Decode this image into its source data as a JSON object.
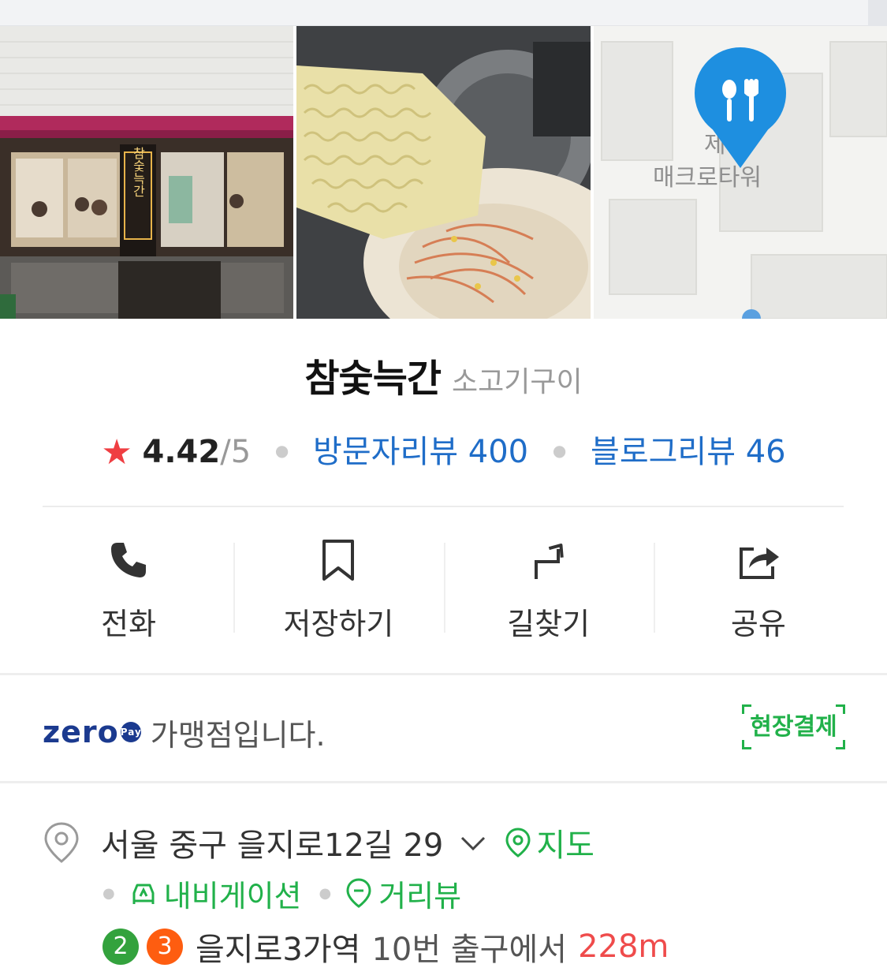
{
  "place": {
    "name": "참숯늑간",
    "category": "소고기구이",
    "sign_text": "참숯늑간",
    "map_label_1": "제",
    "map_label_2": "매크로타워"
  },
  "rating": {
    "score": "4.42",
    "out_of": "/5",
    "visitor_reviews_label": "방문자리뷰",
    "visitor_reviews_count": "400",
    "blog_reviews_label": "블로그리뷰",
    "blog_reviews_count": "46"
  },
  "actions": [
    {
      "label": "전화",
      "icon": "phone-icon"
    },
    {
      "label": "저장하기",
      "icon": "bookmark-icon"
    },
    {
      "label": "길찾기",
      "icon": "directions-icon"
    },
    {
      "label": "공유",
      "icon": "share-icon"
    }
  ],
  "zeropay": {
    "logo": "zero",
    "logo_pay": "Pay",
    "text": "가맹점입니다.",
    "badge": "현장결제"
  },
  "address": {
    "text": "서울 중구 을지로12길 29",
    "map_link": "지도",
    "navigation_link": "내비게이션",
    "streetview_link": "거리뷰",
    "subway_lines": [
      {
        "num": "2",
        "color": "#33a23d"
      },
      {
        "num": "3",
        "color": "#fe5d10"
      }
    ],
    "station": "을지로3가역",
    "exit_text": "10번 출구에서",
    "distance": "228m"
  },
  "colors": {
    "accent_blue": "#1f6dc8",
    "accent_green": "#21b14a",
    "star_red": "#ef3e42",
    "distance_red": "#ef4b4b",
    "map_pin": "#1e8fe0"
  }
}
